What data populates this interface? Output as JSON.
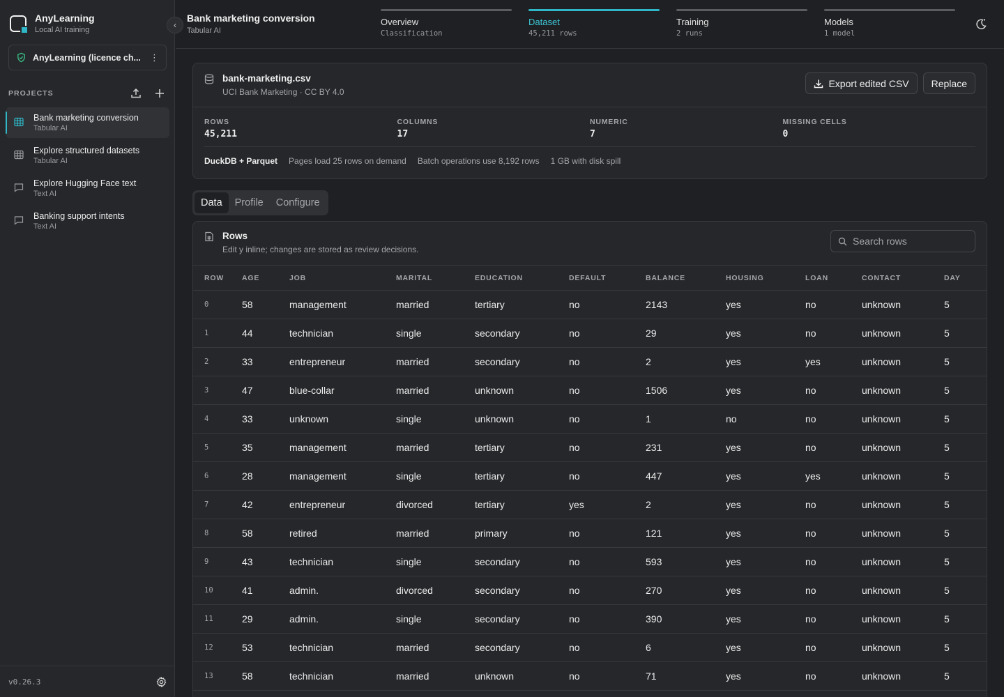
{
  "app": {
    "name": "AnyLearning",
    "subtitle": "Local AI training",
    "version": "v0.26.3"
  },
  "licence": {
    "label": "AnyLearning (licence ch..."
  },
  "sidebar": {
    "projects_label": "PROJECTS",
    "projects": [
      {
        "title": "Bank marketing conversion",
        "sub": "Tabular AI",
        "icon": "table-icon"
      },
      {
        "title": "Explore structured datasets",
        "sub": "Tabular AI",
        "icon": "table-icon"
      },
      {
        "title": "Explore Hugging Face text",
        "sub": "Text AI",
        "icon": "message-icon"
      },
      {
        "title": "Banking support intents",
        "sub": "Text AI",
        "icon": "message-icon"
      }
    ]
  },
  "header": {
    "title": "Bank marketing conversion",
    "subtitle": "Tabular AI",
    "steps": [
      {
        "label": "Overview",
        "sub": "Classification"
      },
      {
        "label": "Dataset",
        "sub": "45,211 rows"
      },
      {
        "label": "Training",
        "sub": "2 runs"
      },
      {
        "label": "Models",
        "sub": "1 model"
      }
    ],
    "active_step": "Dataset"
  },
  "dataset": {
    "file": "bank-marketing.csv",
    "source": "UCI Bank Marketing · CC BY 4.0",
    "export_label": "Export edited CSV",
    "replace_label": "Replace",
    "stats": [
      {
        "label": "ROWS",
        "value": "45,211"
      },
      {
        "label": "COLUMNS",
        "value": "17"
      },
      {
        "label": "NUMERIC",
        "value": "7"
      },
      {
        "label": "MISSING CELLS",
        "value": "0"
      }
    ],
    "engine": "DuckDB + Parquet",
    "notes": [
      "Pages load 25 rows on demand",
      "Batch operations use 8,192 rows",
      "1 GB with disk spill"
    ]
  },
  "tabs": [
    "Data",
    "Profile",
    "Configure"
  ],
  "active_tab": "Data",
  "rows_panel": {
    "title": "Rows",
    "subtitle": "Edit y inline; changes are stored as review decisions.",
    "search_placeholder": "Search rows",
    "columns": [
      "ROW",
      "AGE",
      "JOB",
      "MARITAL",
      "EDUCATION",
      "DEFAULT",
      "BALANCE",
      "HOUSING",
      "LOAN",
      "CONTACT",
      "DAY"
    ],
    "rows": [
      [
        "0",
        "58",
        "management",
        "married",
        "tertiary",
        "no",
        "2143",
        "yes",
        "no",
        "unknown",
        "5"
      ],
      [
        "1",
        "44",
        "technician",
        "single",
        "secondary",
        "no",
        "29",
        "yes",
        "no",
        "unknown",
        "5"
      ],
      [
        "2",
        "33",
        "entrepreneur",
        "married",
        "secondary",
        "no",
        "2",
        "yes",
        "yes",
        "unknown",
        "5"
      ],
      [
        "3",
        "47",
        "blue-collar",
        "married",
        "unknown",
        "no",
        "1506",
        "yes",
        "no",
        "unknown",
        "5"
      ],
      [
        "4",
        "33",
        "unknown",
        "single",
        "unknown",
        "no",
        "1",
        "no",
        "no",
        "unknown",
        "5"
      ],
      [
        "5",
        "35",
        "management",
        "married",
        "tertiary",
        "no",
        "231",
        "yes",
        "no",
        "unknown",
        "5"
      ],
      [
        "6",
        "28",
        "management",
        "single",
        "tertiary",
        "no",
        "447",
        "yes",
        "yes",
        "unknown",
        "5"
      ],
      [
        "7",
        "42",
        "entrepreneur",
        "divorced",
        "tertiary",
        "yes",
        "2",
        "yes",
        "no",
        "unknown",
        "5"
      ],
      [
        "8",
        "58",
        "retired",
        "married",
        "primary",
        "no",
        "121",
        "yes",
        "no",
        "unknown",
        "5"
      ],
      [
        "9",
        "43",
        "technician",
        "single",
        "secondary",
        "no",
        "593",
        "yes",
        "no",
        "unknown",
        "5"
      ],
      [
        "10",
        "41",
        "admin.",
        "divorced",
        "secondary",
        "no",
        "270",
        "yes",
        "no",
        "unknown",
        "5"
      ],
      [
        "11",
        "29",
        "admin.",
        "single",
        "secondary",
        "no",
        "390",
        "yes",
        "no",
        "unknown",
        "5"
      ],
      [
        "12",
        "53",
        "technician",
        "married",
        "secondary",
        "no",
        "6",
        "yes",
        "no",
        "unknown",
        "5"
      ],
      [
        "13",
        "58",
        "technician",
        "married",
        "unknown",
        "no",
        "71",
        "yes",
        "no",
        "unknown",
        "5"
      ]
    ]
  },
  "colors": {
    "accent": "#2fb7c7",
    "background": "#1f2023",
    "panel": "#25272a"
  }
}
